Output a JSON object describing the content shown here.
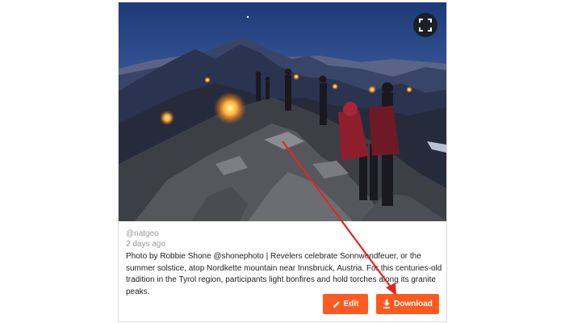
{
  "post": {
    "handle": "@natgeo",
    "time_ago": "2 days ago",
    "caption": "Photo by Robbie Shone @shonephoto | Revelers celebrate Sonnwendfeuer, or the summer solstice, atop Nordkette mountain near Innsbruck, Austria. For this centuries-old tradition in the Tyrol region, participants light bonfires and hold torches along its granite peaks."
  },
  "buttons": {
    "edit_label": "Edit",
    "download_label": "Download",
    "edit_icon": "pencil-icon",
    "download_icon": "download-icon",
    "expand_icon": "fullscreen-icon"
  },
  "colors": {
    "accent": "#ff5a1f",
    "annotation_arrow": "#e0271f"
  }
}
